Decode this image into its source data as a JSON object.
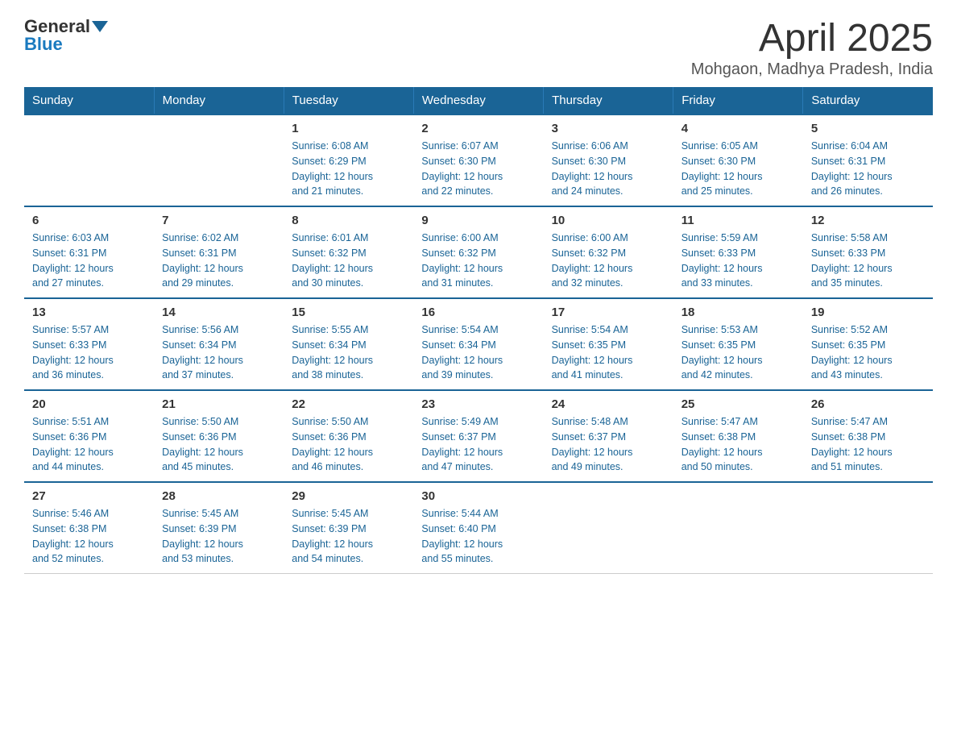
{
  "header": {
    "logo_general": "General",
    "logo_blue": "Blue",
    "month_title": "April 2025",
    "location": "Mohgaon, Madhya Pradesh, India"
  },
  "days_of_week": [
    "Sunday",
    "Monday",
    "Tuesday",
    "Wednesday",
    "Thursday",
    "Friday",
    "Saturday"
  ],
  "weeks": [
    [
      {
        "day": "",
        "info": ""
      },
      {
        "day": "",
        "info": ""
      },
      {
        "day": "1",
        "info": "Sunrise: 6:08 AM\nSunset: 6:29 PM\nDaylight: 12 hours\nand 21 minutes."
      },
      {
        "day": "2",
        "info": "Sunrise: 6:07 AM\nSunset: 6:30 PM\nDaylight: 12 hours\nand 22 minutes."
      },
      {
        "day": "3",
        "info": "Sunrise: 6:06 AM\nSunset: 6:30 PM\nDaylight: 12 hours\nand 24 minutes."
      },
      {
        "day": "4",
        "info": "Sunrise: 6:05 AM\nSunset: 6:30 PM\nDaylight: 12 hours\nand 25 minutes."
      },
      {
        "day": "5",
        "info": "Sunrise: 6:04 AM\nSunset: 6:31 PM\nDaylight: 12 hours\nand 26 minutes."
      }
    ],
    [
      {
        "day": "6",
        "info": "Sunrise: 6:03 AM\nSunset: 6:31 PM\nDaylight: 12 hours\nand 27 minutes."
      },
      {
        "day": "7",
        "info": "Sunrise: 6:02 AM\nSunset: 6:31 PM\nDaylight: 12 hours\nand 29 minutes."
      },
      {
        "day": "8",
        "info": "Sunrise: 6:01 AM\nSunset: 6:32 PM\nDaylight: 12 hours\nand 30 minutes."
      },
      {
        "day": "9",
        "info": "Sunrise: 6:00 AM\nSunset: 6:32 PM\nDaylight: 12 hours\nand 31 minutes."
      },
      {
        "day": "10",
        "info": "Sunrise: 6:00 AM\nSunset: 6:32 PM\nDaylight: 12 hours\nand 32 minutes."
      },
      {
        "day": "11",
        "info": "Sunrise: 5:59 AM\nSunset: 6:33 PM\nDaylight: 12 hours\nand 33 minutes."
      },
      {
        "day": "12",
        "info": "Sunrise: 5:58 AM\nSunset: 6:33 PM\nDaylight: 12 hours\nand 35 minutes."
      }
    ],
    [
      {
        "day": "13",
        "info": "Sunrise: 5:57 AM\nSunset: 6:33 PM\nDaylight: 12 hours\nand 36 minutes."
      },
      {
        "day": "14",
        "info": "Sunrise: 5:56 AM\nSunset: 6:34 PM\nDaylight: 12 hours\nand 37 minutes."
      },
      {
        "day": "15",
        "info": "Sunrise: 5:55 AM\nSunset: 6:34 PM\nDaylight: 12 hours\nand 38 minutes."
      },
      {
        "day": "16",
        "info": "Sunrise: 5:54 AM\nSunset: 6:34 PM\nDaylight: 12 hours\nand 39 minutes."
      },
      {
        "day": "17",
        "info": "Sunrise: 5:54 AM\nSunset: 6:35 PM\nDaylight: 12 hours\nand 41 minutes."
      },
      {
        "day": "18",
        "info": "Sunrise: 5:53 AM\nSunset: 6:35 PM\nDaylight: 12 hours\nand 42 minutes."
      },
      {
        "day": "19",
        "info": "Sunrise: 5:52 AM\nSunset: 6:35 PM\nDaylight: 12 hours\nand 43 minutes."
      }
    ],
    [
      {
        "day": "20",
        "info": "Sunrise: 5:51 AM\nSunset: 6:36 PM\nDaylight: 12 hours\nand 44 minutes."
      },
      {
        "day": "21",
        "info": "Sunrise: 5:50 AM\nSunset: 6:36 PM\nDaylight: 12 hours\nand 45 minutes."
      },
      {
        "day": "22",
        "info": "Sunrise: 5:50 AM\nSunset: 6:36 PM\nDaylight: 12 hours\nand 46 minutes."
      },
      {
        "day": "23",
        "info": "Sunrise: 5:49 AM\nSunset: 6:37 PM\nDaylight: 12 hours\nand 47 minutes."
      },
      {
        "day": "24",
        "info": "Sunrise: 5:48 AM\nSunset: 6:37 PM\nDaylight: 12 hours\nand 49 minutes."
      },
      {
        "day": "25",
        "info": "Sunrise: 5:47 AM\nSunset: 6:38 PM\nDaylight: 12 hours\nand 50 minutes."
      },
      {
        "day": "26",
        "info": "Sunrise: 5:47 AM\nSunset: 6:38 PM\nDaylight: 12 hours\nand 51 minutes."
      }
    ],
    [
      {
        "day": "27",
        "info": "Sunrise: 5:46 AM\nSunset: 6:38 PM\nDaylight: 12 hours\nand 52 minutes."
      },
      {
        "day": "28",
        "info": "Sunrise: 5:45 AM\nSunset: 6:39 PM\nDaylight: 12 hours\nand 53 minutes."
      },
      {
        "day": "29",
        "info": "Sunrise: 5:45 AM\nSunset: 6:39 PM\nDaylight: 12 hours\nand 54 minutes."
      },
      {
        "day": "30",
        "info": "Sunrise: 5:44 AM\nSunset: 6:40 PM\nDaylight: 12 hours\nand 55 minutes."
      },
      {
        "day": "",
        "info": ""
      },
      {
        "day": "",
        "info": ""
      },
      {
        "day": "",
        "info": ""
      }
    ]
  ]
}
